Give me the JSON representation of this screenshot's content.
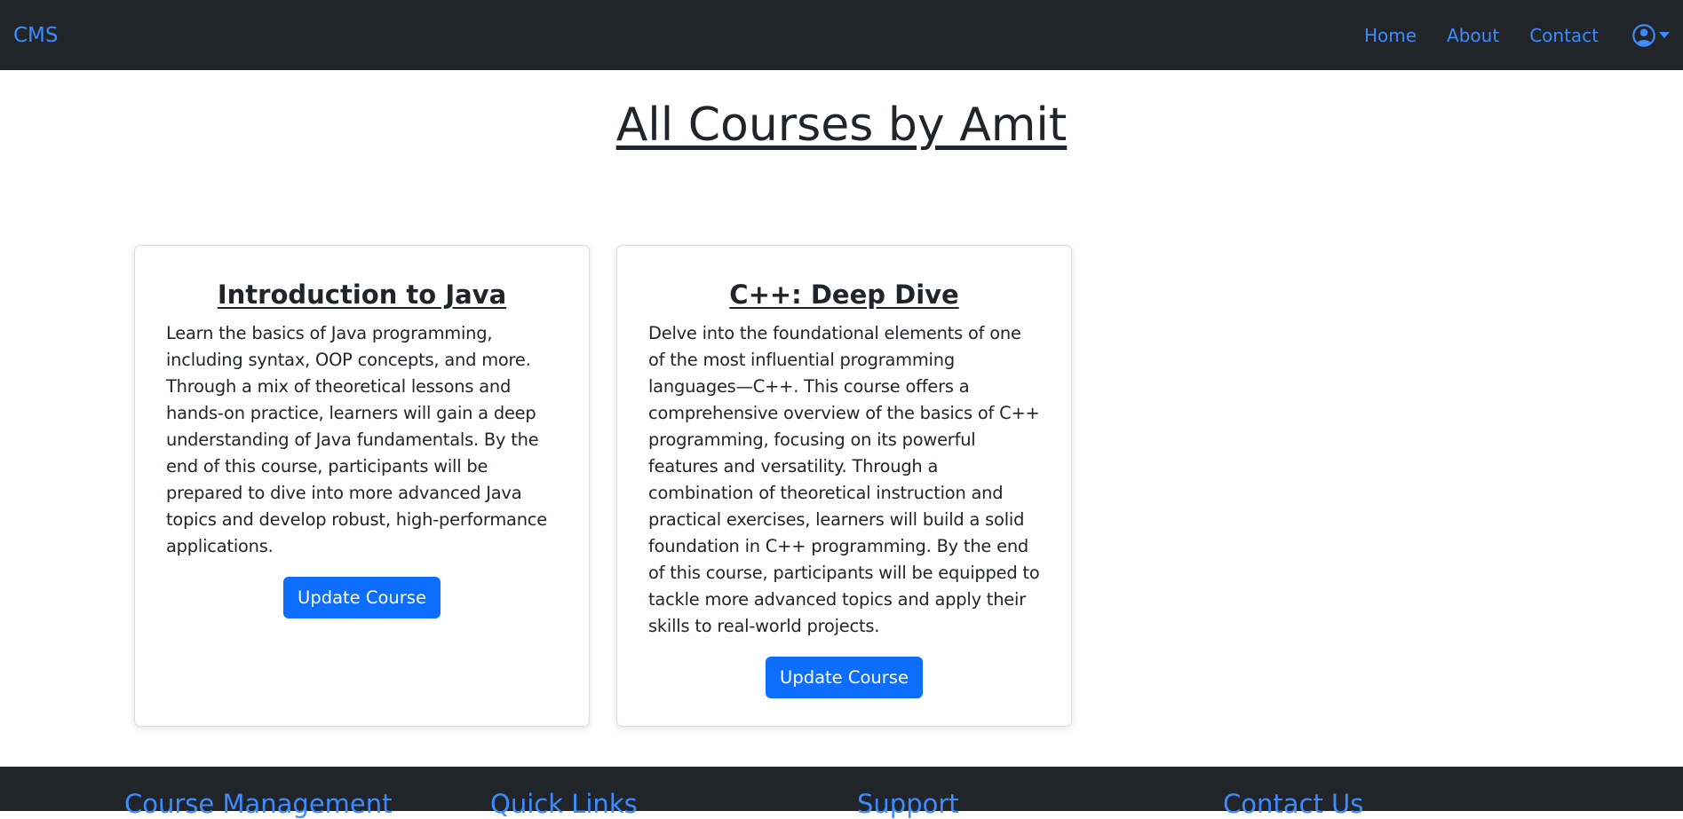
{
  "nav": {
    "brand": "CMS",
    "links": [
      "Home",
      "About",
      "Contact"
    ]
  },
  "page_title": "All Courses by Amit",
  "courses": [
    {
      "title": "Introduction to Java",
      "description": "Learn the basics of Java programming, including syntax, OOP concepts, and more. Through a mix of theoretical lessons and hands-on practice, learners will gain a deep understanding of Java fundamentals. By the end of this course, participants will be prepared to dive into more advanced Java topics and develop robust, high-performance applications.",
      "button": "Update Course"
    },
    {
      "title": "C++: Deep Dive",
      "description": "Delve into the foundational elements of one of the most influential programming languages—C++. This course offers a comprehensive overview of the basics of C++ programming, focusing on its powerful features and versatility. Through a combination of theoretical instruction and practical exercises, learners will build a solid foundation in C++ programming. By the end of this course, participants will be equipped to tackle more advanced topics and apply their skills to real-world projects.",
      "button": "Update Course"
    }
  ],
  "footer": {
    "columns": [
      "Course Management",
      "Quick Links",
      "Support",
      "Contact Us"
    ]
  },
  "colors": {
    "navbar": "#212529",
    "link": "#3d8bfd",
    "primary_button": "#0d6efd"
  },
  "icons": {
    "user_menu": "user-circle-icon",
    "dropdown": "caret-down-icon"
  }
}
